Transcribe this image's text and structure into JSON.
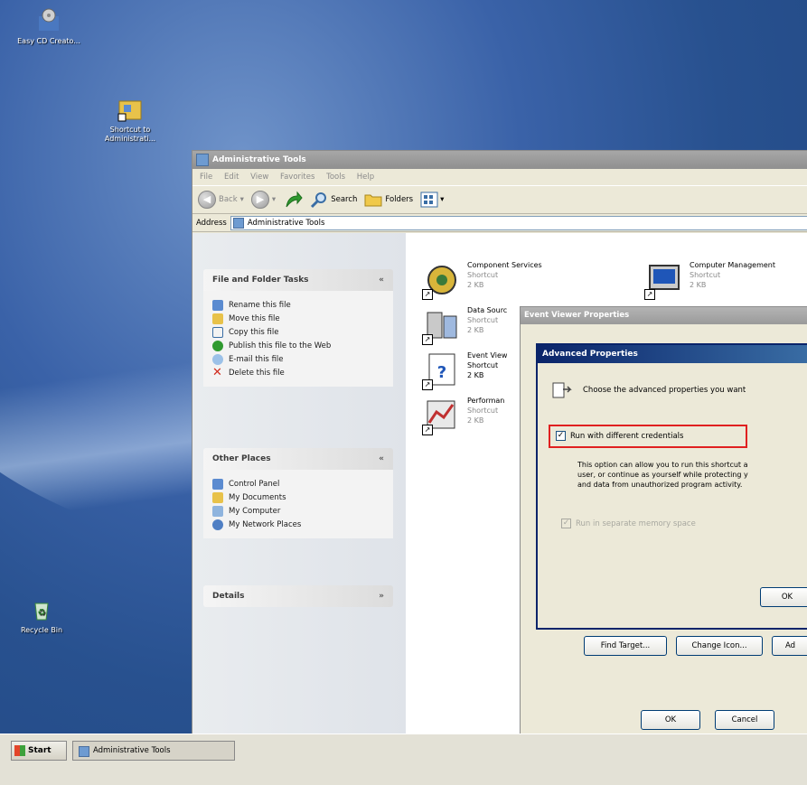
{
  "desktop": {
    "icons": [
      {
        "label": "Easy CD Creato...",
        "icon": "cd-creator-icon"
      },
      {
        "label": "Shortcut to Administrati...",
        "icon": "admin-shortcut-icon"
      },
      {
        "label": "Recycle Bin",
        "icon": "recycle-bin-icon"
      }
    ]
  },
  "explorer": {
    "title": "Administrative Tools",
    "menu": [
      "File",
      "Edit",
      "View",
      "Favorites",
      "Tools",
      "Help"
    ],
    "toolbar": {
      "back": "Back",
      "search": "Search",
      "folders": "Folders"
    },
    "address_label": "Address",
    "address_value": "Administrative Tools",
    "file_tasks": {
      "title": "File and Folder Tasks",
      "items": [
        "Rename this file",
        "Move this file",
        "Copy this file",
        "Publish this file to the Web",
        "E-mail this file",
        "Delete this file"
      ]
    },
    "other_places": {
      "title": "Other Places",
      "items": [
        "Control Panel",
        "My Documents",
        "My Computer",
        "My Network Places"
      ]
    },
    "details": {
      "title": "Details"
    },
    "files": [
      {
        "name": "Component Services",
        "type": "Shortcut",
        "size": "2 KB"
      },
      {
        "name": "Computer Management",
        "type": "Shortcut",
        "size": "2 KB"
      },
      {
        "name": "Data Sourc",
        "type": "Shortcut",
        "size": "2 KB"
      },
      {
        "name": "Event View",
        "type": "Shortcut",
        "size": "2 KB"
      },
      {
        "name": "Performan",
        "type": "Shortcut",
        "size": "2 KB"
      }
    ]
  },
  "event_viewer_dialog": {
    "title": "Event Viewer Properties",
    "buttons": {
      "find_target": "Find Target...",
      "change_icon": "Change Icon...",
      "advanced": "Ad",
      "ok": "OK",
      "cancel": "Cancel"
    }
  },
  "advanced_dialog": {
    "title": "Advanced Properties",
    "prompt": "Choose the advanced properties you want",
    "run_diff_label": "Run with different credentials",
    "run_diff_checked": true,
    "description_lines": [
      "This option can allow you to run this shortcut a",
      "user, or continue as yourself while protecting y",
      "and data from unauthorized program activity."
    ],
    "separate_memory_label": "Run in separate memory space",
    "ok": "OK"
  },
  "taskbar": {
    "start": "Start",
    "task": "Administrative Tools"
  },
  "colors": {
    "highlight_box": "#e02020",
    "active_title": "#0a246a"
  }
}
